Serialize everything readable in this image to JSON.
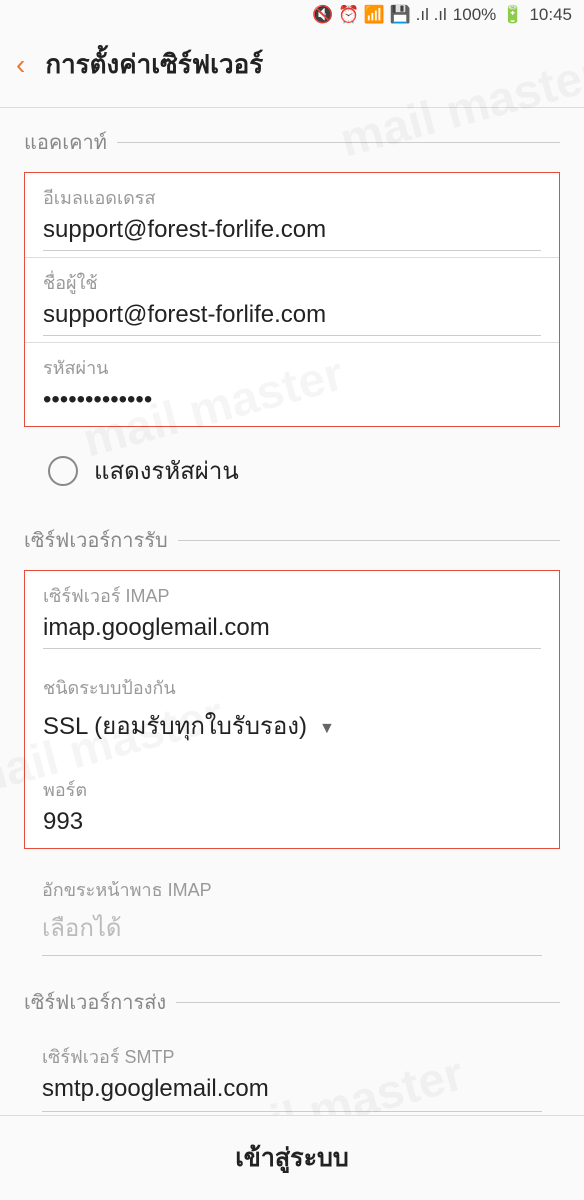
{
  "status": {
    "icons": "🔇 ⏰ 📶 💾 📶 📶",
    "battery": "100%",
    "batt_icon": "🔋",
    "time": "10:45"
  },
  "header": {
    "title": "การตั้งค่าเซิร์ฟเวอร์"
  },
  "account": {
    "section_label": "แอคเคาท์",
    "email_label": "อีเมลแอดเดรส",
    "email_value": "support@forest-forlife.com",
    "username_label": "ชื่อผู้ใช้",
    "username_value": "support@forest-forlife.com",
    "password_label": "รหัสผ่าน",
    "password_value": "•••••••••••••",
    "show_password": "แสดงรหัสผ่าน"
  },
  "incoming": {
    "section_label": "เซิร์ฟเวอร์การรับ",
    "server_label": "เซิร์ฟเวอร์ IMAP",
    "server_value": "imap.googlemail.com",
    "security_label": "ชนิดระบบป้องกัน",
    "security_value": "SSL (ยอมรับทุกใบรับรอง)",
    "port_label": "พอร์ต",
    "port_value": "993",
    "path_label": "อักขระหน้าพาธ IMAP",
    "path_placeholder": "เลือกได้"
  },
  "outgoing": {
    "section_label": "เซิร์ฟเวอร์การส่ง",
    "server_label": "เซิร์ฟเวอร์ SMTP",
    "server_value": "smtp.googlemail.com"
  },
  "footer": {
    "login": "เข้าสู่ระบบ"
  }
}
